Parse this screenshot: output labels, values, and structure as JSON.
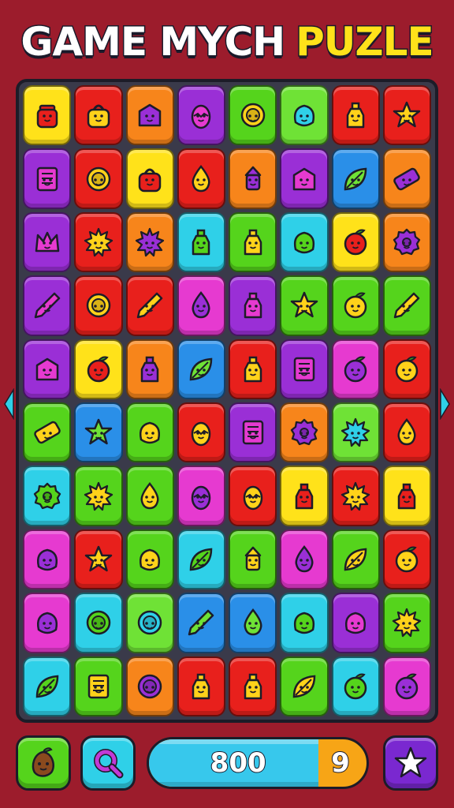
{
  "header": {
    "title_part1": "GAME MYCH",
    "title_part2": "PUZLE"
  },
  "colors": {
    "background": "#9c1c2c",
    "title_accent": "#ffe21a"
  },
  "board": {
    "rows": 10,
    "cols": 8,
    "tiles": [
      {
        "bg": "#ffe21a",
        "icon": "jar"
      },
      {
        "bg": "#e8201c",
        "icon": "bag"
      },
      {
        "bg": "#f7851b",
        "icon": "box"
      },
      {
        "bg": "#9a2fd6",
        "icon": "egg"
      },
      {
        "bg": "#55d41c",
        "icon": "coin"
      },
      {
        "bg": "#6fe236",
        "icon": "blob"
      },
      {
        "bg": "#e8201c",
        "icon": "bottle"
      },
      {
        "bg": "#e8201c",
        "icon": "star"
      },
      {
        "bg": "#9a2fd6",
        "icon": "book"
      },
      {
        "bg": "#e8201c",
        "icon": "coin"
      },
      {
        "bg": "#ffe21a",
        "icon": "bag"
      },
      {
        "bg": "#e8201c",
        "icon": "drop"
      },
      {
        "bg": "#f7851b",
        "icon": "lamp"
      },
      {
        "bg": "#9a2fd6",
        "icon": "box"
      },
      {
        "bg": "#2a8fe8",
        "icon": "leaf"
      },
      {
        "bg": "#f7851b",
        "icon": "bar"
      },
      {
        "bg": "#9a2fd6",
        "icon": "crown"
      },
      {
        "bg": "#e8201c",
        "icon": "sun"
      },
      {
        "bg": "#f7851b",
        "icon": "sun"
      },
      {
        "bg": "#2fd0e8",
        "icon": "bottle"
      },
      {
        "bg": "#55d41c",
        "icon": "bottle"
      },
      {
        "bg": "#2fd0e8",
        "icon": "blob"
      },
      {
        "bg": "#ffe21a",
        "icon": "fruit"
      },
      {
        "bg": "#f7851b",
        "icon": "gear"
      },
      {
        "bg": "#9a2fd6",
        "icon": "pencil"
      },
      {
        "bg": "#e8201c",
        "icon": "coin"
      },
      {
        "bg": "#e8201c",
        "icon": "pencil"
      },
      {
        "bg": "#e63ad0",
        "icon": "drop"
      },
      {
        "bg": "#9a2fd6",
        "icon": "bottle"
      },
      {
        "bg": "#55d41c",
        "icon": "star"
      },
      {
        "bg": "#55d41c",
        "icon": "fruit"
      },
      {
        "bg": "#55d41c",
        "icon": "pencil"
      },
      {
        "bg": "#9a2fd6",
        "icon": "box"
      },
      {
        "bg": "#ffe21a",
        "icon": "fruit"
      },
      {
        "bg": "#f7851b",
        "icon": "bottle"
      },
      {
        "bg": "#2a8fe8",
        "icon": "leaf"
      },
      {
        "bg": "#e8201c",
        "icon": "bottle"
      },
      {
        "bg": "#9a2fd6",
        "icon": "book"
      },
      {
        "bg": "#e63ad0",
        "icon": "fruit"
      },
      {
        "bg": "#e8201c",
        "icon": "fruit"
      },
      {
        "bg": "#55d41c",
        "icon": "bar"
      },
      {
        "bg": "#2a8fe8",
        "icon": "star"
      },
      {
        "bg": "#55d41c",
        "icon": "blob"
      },
      {
        "bg": "#e8201c",
        "icon": "egg"
      },
      {
        "bg": "#9a2fd6",
        "icon": "book"
      },
      {
        "bg": "#f7851b",
        "icon": "gear"
      },
      {
        "bg": "#6fe236",
        "icon": "sun"
      },
      {
        "bg": "#e8201c",
        "icon": "drop"
      },
      {
        "bg": "#2fd0e8",
        "icon": "gear"
      },
      {
        "bg": "#55d41c",
        "icon": "sun"
      },
      {
        "bg": "#55d41c",
        "icon": "drop"
      },
      {
        "bg": "#e63ad0",
        "icon": "egg"
      },
      {
        "bg": "#e8201c",
        "icon": "egg"
      },
      {
        "bg": "#ffe21a",
        "icon": "bottle"
      },
      {
        "bg": "#e8201c",
        "icon": "sun"
      },
      {
        "bg": "#ffe21a",
        "icon": "bottle"
      },
      {
        "bg": "#e63ad0",
        "icon": "blob"
      },
      {
        "bg": "#e8201c",
        "icon": "star"
      },
      {
        "bg": "#55d41c",
        "icon": "blob"
      },
      {
        "bg": "#2fd0e8",
        "icon": "leaf"
      },
      {
        "bg": "#55d41c",
        "icon": "lamp"
      },
      {
        "bg": "#e63ad0",
        "icon": "drop"
      },
      {
        "bg": "#55d41c",
        "icon": "leaf"
      },
      {
        "bg": "#e8201c",
        "icon": "fruit"
      },
      {
        "bg": "#e63ad0",
        "icon": "blob"
      },
      {
        "bg": "#2fd0e8",
        "icon": "coin"
      },
      {
        "bg": "#6fe236",
        "icon": "coin"
      },
      {
        "bg": "#2a8fe8",
        "icon": "pencil"
      },
      {
        "bg": "#2a8fe8",
        "icon": "drop"
      },
      {
        "bg": "#2fd0e8",
        "icon": "blob"
      },
      {
        "bg": "#9a2fd6",
        "icon": "blob"
      },
      {
        "bg": "#55d41c",
        "icon": "sun"
      },
      {
        "bg": "#2fd0e8",
        "icon": "leaf"
      },
      {
        "bg": "#55d41c",
        "icon": "book"
      },
      {
        "bg": "#f7851b",
        "icon": "coin"
      },
      {
        "bg": "#e8201c",
        "icon": "bottle"
      },
      {
        "bg": "#e8201c",
        "icon": "bottle"
      },
      {
        "bg": "#55d41c",
        "icon": "leaf"
      },
      {
        "bg": "#2fd0e8",
        "icon": "fruit"
      },
      {
        "bg": "#e63ad0",
        "icon": "fruit"
      }
    ]
  },
  "footer": {
    "left_button_icon": "seed-icon",
    "search_button_icon": "magnifier-icon",
    "star_button_icon": "star-icon",
    "score": "800",
    "counter": "9",
    "progress": 0.78
  }
}
